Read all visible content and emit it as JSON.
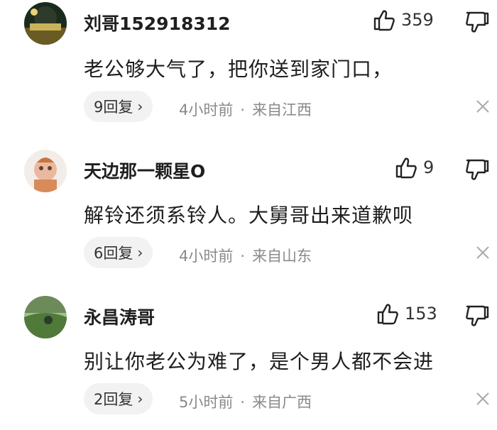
{
  "comments": [
    {
      "username": "刘哥152918312",
      "likes": "359",
      "content": "老公够大气了，把你送到家门口，",
      "replies": "9回复",
      "time": "4小时前",
      "separator": "·",
      "location": "来自江西"
    },
    {
      "username": "天边那一颗星O",
      "likes": "9",
      "content": "解铃还须系铃人。大舅哥出来道歉呗",
      "replies": "6回复",
      "time": "4小时前",
      "separator": "·",
      "location": "来自山东"
    },
    {
      "username": "永昌涛哥",
      "likes": "153",
      "content": "别让你老公为难了，是个男人都不会进",
      "replies": "2回复",
      "time": "5小时前",
      "separator": "·",
      "location": "来自广西"
    }
  ],
  "icons": {
    "reply_chevron": "›",
    "like": "thumbs-up-icon",
    "dislike": "thumbs-down-icon",
    "close": "close-icon"
  }
}
